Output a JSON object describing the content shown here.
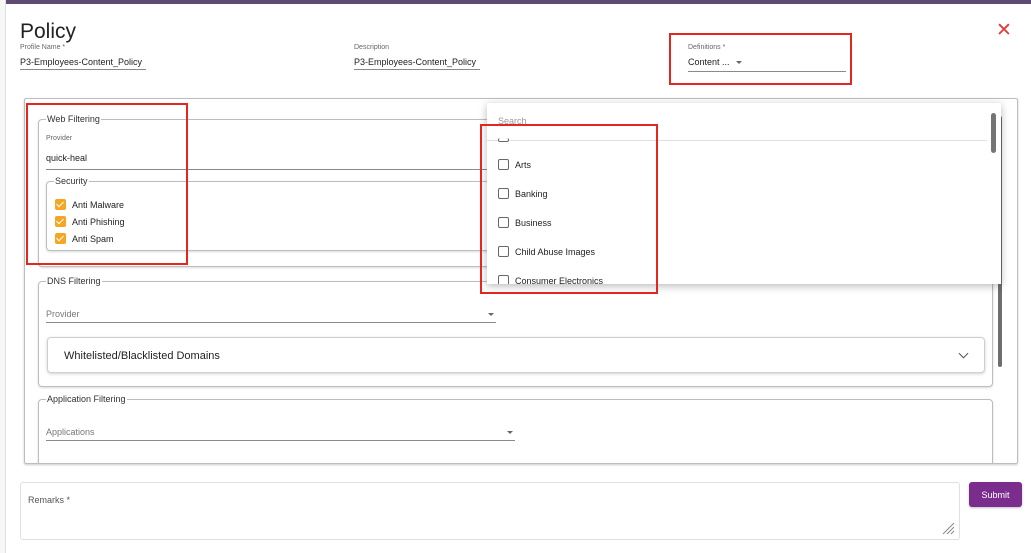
{
  "dialog": {
    "title": "Policy",
    "close_icon": "close-icon"
  },
  "fields": {
    "profile_name": {
      "label": "Profile Name *",
      "value": "P3-Employees-Content_Policy"
    },
    "description": {
      "label": "Description",
      "value": "P3-Employees-Content_Policy"
    },
    "definitions": {
      "label": "Definitions *",
      "value": "Content ..."
    }
  },
  "web_filtering": {
    "legend": "Web Filtering",
    "provider_label": "Provider",
    "provider_value": "quick-heal",
    "security": {
      "legend": "Security",
      "items": [
        {
          "label": "Anti Malware",
          "checked": true
        },
        {
          "label": "Anti Phishing",
          "checked": true
        },
        {
          "label": "Anti Spam",
          "checked": true
        }
      ]
    }
  },
  "dns_filtering": {
    "legend": "DNS Filtering",
    "provider_placeholder": "Provider",
    "domains_panel_title": "Whitelisted/Blacklisted Domains"
  },
  "application_filtering": {
    "legend": "Application Filtering",
    "applications_placeholder": "Applications"
  },
  "dropdown": {
    "search_placeholder": "Search",
    "options": [
      {
        "label": "Arts",
        "checked": false
      },
      {
        "label": "Banking",
        "checked": false
      },
      {
        "label": "Business",
        "checked": false
      },
      {
        "label": "Child Abuse Images",
        "checked": false
      },
      {
        "label": "Consumer Electronics",
        "checked": false
      }
    ]
  },
  "remarks": {
    "label": "Remarks *"
  },
  "actions": {
    "submit_label": "Submit"
  },
  "colors": {
    "accent_checkbox": "#f5a623",
    "submit_bg": "#7b2d8e",
    "close": "#e53935",
    "highlight_box": "#e3261f"
  }
}
